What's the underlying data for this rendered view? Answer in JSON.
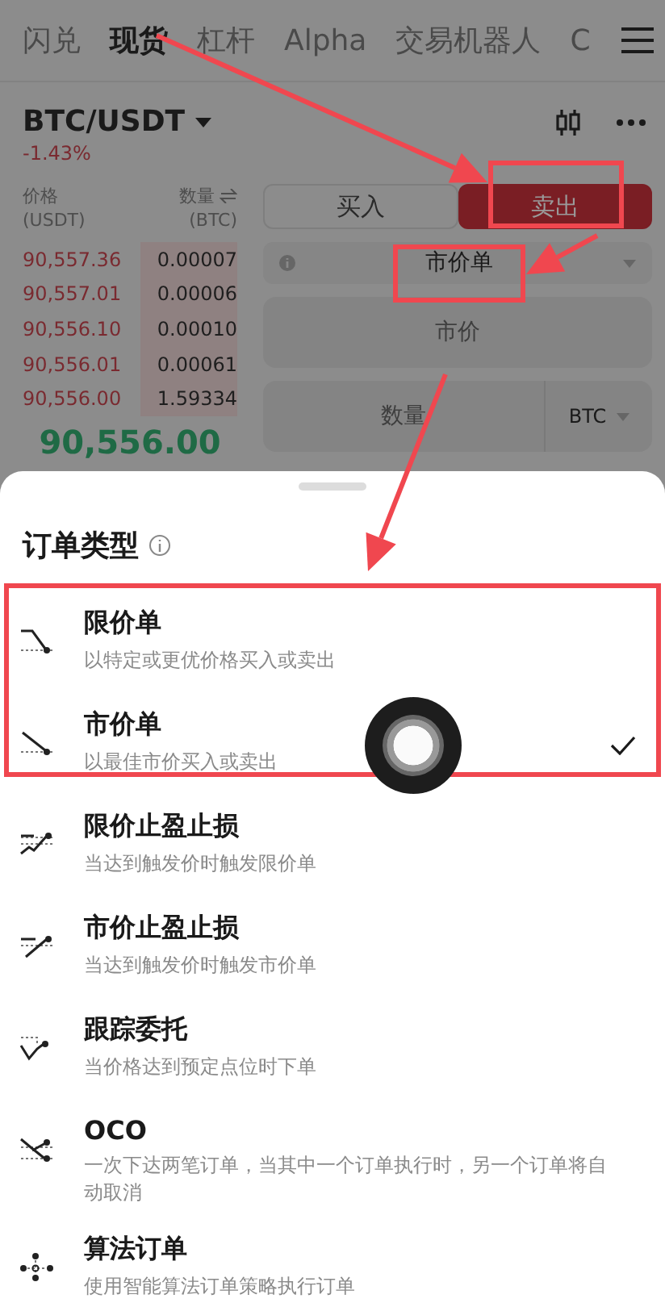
{
  "top_tabs": [
    {
      "label": "闪兑",
      "selected": false
    },
    {
      "label": "现货",
      "selected": true
    },
    {
      "label": "杠杆",
      "selected": false
    },
    {
      "label": "Alpha",
      "selected": false
    },
    {
      "label": "交易机器人",
      "selected": false
    },
    {
      "label": "C",
      "selected": false
    }
  ],
  "pair": {
    "symbol": "BTC/USDT",
    "change": "-1.43%"
  },
  "order_book": {
    "price_header": "价格",
    "price_unit": "(USDT)",
    "qty_header": "数量",
    "qty_unit": "(BTC)",
    "asks": [
      {
        "price": "90,557.36",
        "qty": "0.00007"
      },
      {
        "price": "90,557.01",
        "qty": "0.00006"
      },
      {
        "price": "90,556.10",
        "qty": "0.00010"
      },
      {
        "price": "90,556.01",
        "qty": "0.00061"
      },
      {
        "price": "90,556.00",
        "qty": "1.59334"
      }
    ],
    "last_price": "90,556.00"
  },
  "trade_form": {
    "sides": [
      {
        "label": "买入",
        "selected": false
      },
      {
        "label": "卖出",
        "selected": true
      }
    ],
    "order_type": "市价单",
    "price_field": {
      "placeholder": "市价"
    },
    "quantity_field": {
      "placeholder": "数量",
      "unit": "BTC"
    }
  },
  "sheet": {
    "title": "订单类型",
    "options": [
      {
        "kind": "limit",
        "title": "限价单",
        "description": "以特定或更优价格买入或卖出",
        "selected": false
      },
      {
        "kind": "market",
        "title": "市价单",
        "description": "以最佳市价买入或卖出",
        "selected": true
      },
      {
        "kind": "limit-tpsl",
        "title": "限价止盈止损",
        "description": "当达到触发价时触发限价单",
        "selected": false
      },
      {
        "kind": "market-tpsl",
        "title": "市价止盈止损",
        "description": "当达到触发价时触发市价单",
        "selected": false
      },
      {
        "kind": "trailing",
        "title": "跟踪委托",
        "description": "当价格达到预定点位时下单",
        "selected": false
      },
      {
        "kind": "oco",
        "title": "OCO",
        "description": "一次下达两笔订单，当其中一个订单执行时，另一个订单将自动取消",
        "selected": false
      },
      {
        "kind": "algo",
        "title": "算法订单",
        "description": "使用智能算法订单策略执行订单",
        "selected": false
      }
    ]
  }
}
